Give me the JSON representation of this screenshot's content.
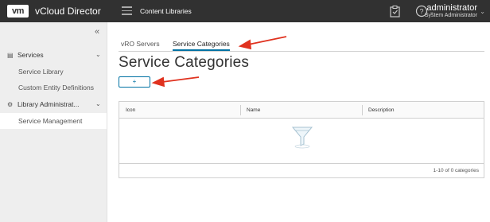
{
  "header": {
    "logo_text": "vm",
    "app_title": "vCloud Director",
    "nav_link": "Content Libraries",
    "user_name": "administrator",
    "user_role": "System Administrator"
  },
  "sidebar": {
    "groups": [
      {
        "label": "Services",
        "icon": "services-icon",
        "items": [
          {
            "label": "Service Library"
          },
          {
            "label": "Custom Entity Definitions"
          }
        ]
      },
      {
        "label": "Library Administrat...",
        "icon": "gear-icon",
        "items": [
          {
            "label": "Service Management",
            "active": true
          }
        ]
      }
    ]
  },
  "main": {
    "tabs": [
      {
        "label": "vRO Servers",
        "active": false
      },
      {
        "label": "Service Categories",
        "active": true
      }
    ],
    "title": "Service Categories",
    "add_button_label": "+",
    "grid": {
      "columns": [
        "Icon",
        "Name",
        "Description"
      ],
      "rows": [],
      "footer": "1-10 of 0 categories"
    }
  },
  "colors": {
    "topbar": "#313131",
    "sidebar": "#eeeeee",
    "accent": "#0072a3",
    "annotation_arrow": "#e0321f"
  }
}
